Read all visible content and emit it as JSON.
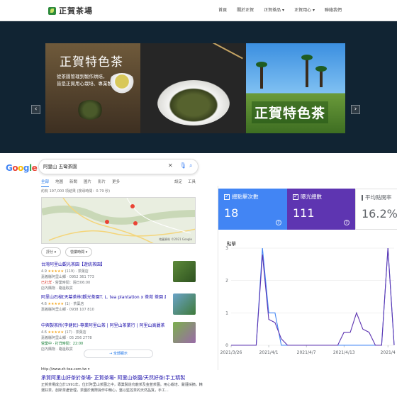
{
  "header": {
    "brand": "正賀茶場",
    "nav": [
      "首頁",
      "關於正賀",
      "正賀茶品 ▾",
      "正賀用心 ▾",
      "聯絡我們"
    ]
  },
  "hero": {
    "title_left": "正賀特色茶",
    "subtitle_lines": [
      "從茶園管理到製作烘焙，",
      "皆是正賀用心栽培、專業製作"
    ],
    "title_right": "正賀特色茶",
    "prev_icon": "‹",
    "next_icon": "›"
  },
  "serp": {
    "logo_letters": [
      "G",
      "o",
      "o",
      "g",
      "l",
      "e"
    ],
    "logo_colors": [
      "#4285f4",
      "#ea4335",
      "#fbbc05",
      "#4285f4",
      "#34a853",
      "#ea4335"
    ],
    "query": "阿里山 五彎茶園",
    "tabs": [
      "全部",
      "地圖",
      "新聞",
      "圖片",
      "影片",
      "更多"
    ],
    "tools": [
      "設定",
      "工具"
    ],
    "results_count": "約有 197,000 項結果 (搜尋時間：0.79 秒)",
    "map_footer": "地圖資料 ©2021 Google",
    "filters": [
      "評分 ▾",
      "營業時間 ▾"
    ],
    "listings": [
      {
        "name": "台灣阿里山觀光茶園【遊統茶園】",
        "rating": "4.9",
        "stars": "★★★★★",
        "reviews": "(119) · 茶葉店",
        "line2": "嘉義縣阿里山鄉 · 0952 361 773",
        "line3_open": "已打烊",
        "line3_rest": " · 營業時間：週日06:00",
        "line4": "店內購物 · 路邊取貨"
      },
      {
        "name": "阿里山石棹[天幕茶林]觀光茶園T. L. tea plantation x 茶苑 茶園 農園",
        "rating": "4.6",
        "stars": "★★★★★",
        "reviews": "(1) · 茶葉店",
        "line2": "嘉義縣阿里山鄉 · 0938 107 810",
        "line3_open": "",
        "line3_rest": "",
        "line4": ""
      },
      {
        "name": "中興製茶所(李健民)-專業阿里山茶 | 阿里山茶業行 | 阿里山高麗茶 | 阿里山紅",
        "rating": "4.6",
        "stars": "★★★★★",
        "reviews": "(17) · 茶葉店",
        "line2": "嘉義縣阿里山鄉 · 05 256 2778",
        "line3_open": "",
        "line3_rest": "營業中 · 打烊時間：22:00",
        "line4": "店內購物 · 路邊取貨"
      }
    ],
    "more_button": "→    全部顯示",
    "organic": {
      "url": "http://www.zh-tea.com.tw ▾",
      "title": "承賀阿里山好茶於茶場- 正賀茶場- 阿里山茶園/天然好茶/手工精製",
      "snippet": "正賀茶場成立於1991年，位於阿里山茶園之中，專業製造烏龍茶及金萱茶園。用心栽培、嚴謹採摘，精選好茶，創新茶產管理，茶園於實際操作中精心，整以監控茶的天然品質，手工..."
    }
  },
  "gsc": {
    "cards": [
      {
        "label": "總點擊次數",
        "value": "18"
      },
      {
        "label": "曝光總數",
        "value": "111"
      },
      {
        "label": "平均點閱率",
        "value": "16.2%"
      }
    ],
    "chart_label": "點擊",
    "colors": {
      "clicks": "#4285f4",
      "impressions": "#5e35b1"
    },
    "chart_data": {
      "type": "line",
      "ylabel": "點擊",
      "ylim": [
        0,
        3
      ],
      "yticks": [
        "3",
        "2",
        "1",
        "0"
      ],
      "xticks": [
        "2021/3/26",
        "2021/4/1",
        "2021/4/7",
        "2021/4/13",
        "2021/4"
      ],
      "series": [
        {
          "name": "總點擊次數",
          "values": [
            0,
            0,
            0,
            0,
            0,
            3,
            1,
            1,
            0,
            0,
            0,
            0,
            0,
            0,
            0,
            0,
            0,
            0,
            0,
            0,
            0,
            0,
            0,
            0,
            0,
            3,
            0
          ]
        },
        {
          "name": "曝光總數",
          "values": [
            0,
            0,
            0,
            0,
            0,
            2.8,
            0.8,
            0.7,
            0.2,
            0,
            0,
            0,
            0,
            0,
            0,
            0,
            0,
            0,
            0.4,
            0.4,
            1.0,
            0.5,
            0.4,
            0,
            0,
            3,
            0
          ]
        }
      ]
    }
  }
}
